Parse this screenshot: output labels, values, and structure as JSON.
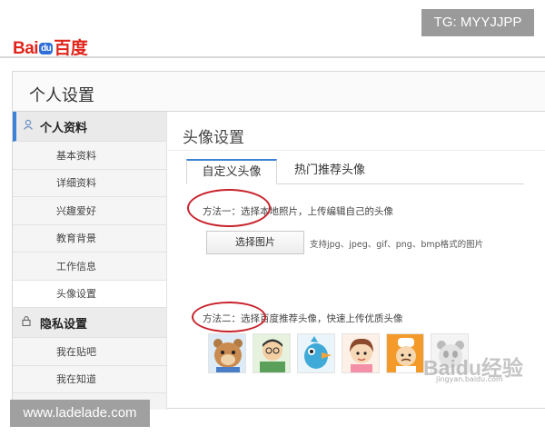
{
  "logo": {
    "part1": "Bai",
    "part2": "du",
    "part3": "百度"
  },
  "watermarks": {
    "tg": "TG: MYYJJPP",
    "site": "www.ladelade.com",
    "baidu_brand": "Baidu经验",
    "baidu_url": "jingyan.baidu.com"
  },
  "page": {
    "title": "个人设置"
  },
  "sidebar": {
    "group1": {
      "label": "个人资料",
      "icon": "person-icon"
    },
    "items": [
      "基本资料",
      "详细资料",
      "兴趣爱好",
      "教育背景",
      "工作信息",
      "头像设置"
    ],
    "group2": {
      "label": "隐私设置",
      "icon": "lock-icon"
    },
    "items2": [
      "我在贴吧",
      "我在知道"
    ]
  },
  "content": {
    "title": "头像设置",
    "tabs": [
      "自定义头像",
      "热门推荐头像"
    ],
    "method1": "方法一：选择本地照片，上传编辑自己的头像",
    "select_button": "选择图片",
    "support_text": "支持jpg、jpeg、gif、png、bmp格式的图片",
    "method2": "方法二：选择百度推荐头像，快速上传优质头像",
    "avatars": [
      "bear-avatar",
      "cartoon-boy-avatar",
      "blue-bird-avatar",
      "girl-avatar",
      "chef-avatar",
      "panda-avatar"
    ]
  },
  "colors": {
    "accent": "#3d82d6",
    "brand_red": "#e1251b",
    "annotation_red": "#c8232c"
  }
}
